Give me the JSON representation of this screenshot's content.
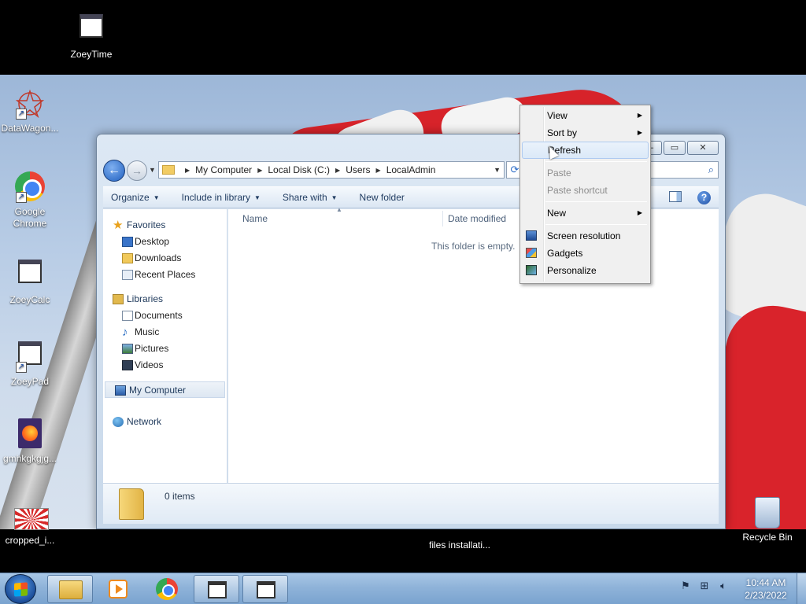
{
  "desktop": {
    "icons": [
      {
        "label": "ZoeyTime",
        "icon": "app-window-icon"
      },
      {
        "label": "DataWagon...",
        "icon": "datawagon-icon"
      },
      {
        "label": "Google Chrome",
        "icon": "chrome-icon"
      },
      {
        "label": "ZoeyCalc",
        "icon": "app-window-icon"
      },
      {
        "label": "ZoeyPad",
        "icon": "app-window-icon"
      },
      {
        "label": "gmhkgkgjg...",
        "icon": "firefox-document-icon"
      },
      {
        "label": "cropped_i...",
        "icon": "image-file-icon"
      },
      {
        "label": "files installati...",
        "icon": "installer-icon"
      },
      {
        "label": "Recycle Bin",
        "icon": "recycle-bin-icon"
      }
    ]
  },
  "explorer": {
    "breadcrumb": [
      "My Computer",
      "Local Disk (C:)",
      "Users",
      "LocalAdmin"
    ],
    "toolbar": {
      "organize": "Organize",
      "include_in_library": "Include in library",
      "share_with": "Share with",
      "new_folder": "New folder"
    },
    "nav": {
      "favorites": "Favorites",
      "desktop": "Desktop",
      "downloads": "Downloads",
      "recent_places": "Recent Places",
      "libraries": "Libraries",
      "documents": "Documents",
      "music": "Music",
      "pictures": "Pictures",
      "videos": "Videos",
      "my_computer": "My Computer",
      "network": "Network"
    },
    "columns": {
      "name": "Name",
      "date_modified": "Date modified"
    },
    "empty_message": "This folder is empty.",
    "status": {
      "items": "0 items"
    }
  },
  "context_menu": {
    "items": [
      {
        "label": "View",
        "submenu": true,
        "enabled": true
      },
      {
        "label": "Sort by",
        "submenu": true,
        "enabled": true
      },
      {
        "label": "Refresh",
        "submenu": false,
        "enabled": true,
        "highlighted": true
      },
      {
        "label": "Paste",
        "submenu": false,
        "enabled": false
      },
      {
        "label": "Paste shortcut",
        "submenu": false,
        "enabled": false
      },
      {
        "label": "New",
        "submenu": true,
        "enabled": true
      },
      {
        "label": "Screen resolution",
        "submenu": false,
        "enabled": true,
        "icon": "screen-resolution-icon"
      },
      {
        "label": "Gadgets",
        "submenu": false,
        "enabled": true,
        "icon": "gadgets-icon"
      },
      {
        "label": "Personalize",
        "submenu": false,
        "enabled": true,
        "icon": "personalize-icon"
      }
    ]
  },
  "taskbar": {
    "buttons": [
      "windows-explorer",
      "media-player",
      "google-chrome",
      "app-window",
      "app-window"
    ],
    "clock": {
      "time": "10:44 AM",
      "date": "2/23/2022"
    }
  }
}
